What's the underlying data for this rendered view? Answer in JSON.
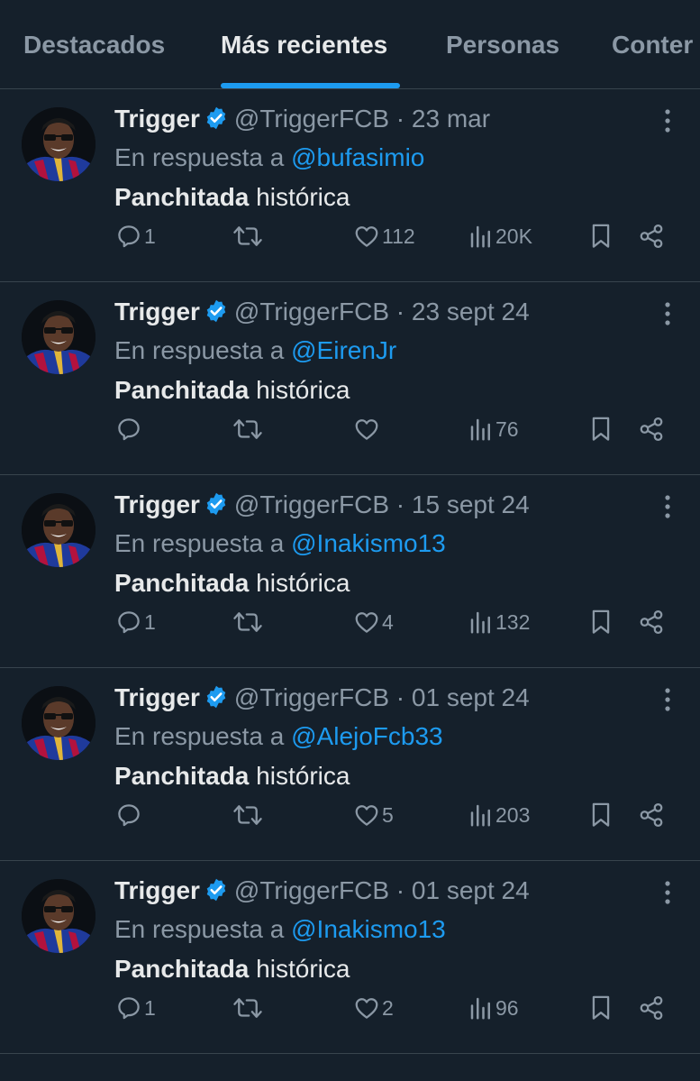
{
  "tabs": [
    {
      "label": "Destacados",
      "active": false
    },
    {
      "label": "Más recientes",
      "active": true
    },
    {
      "label": "Personas",
      "active": false
    },
    {
      "label": "Conter",
      "active": false
    }
  ],
  "colors": {
    "accent": "#1d9bf0",
    "background": "#15202b",
    "muted": "#8b98a5",
    "text": "#e7e9ea"
  },
  "tweets": [
    {
      "name": "Trigger",
      "handle": "@TriggerFCB",
      "sep": "·",
      "date": "23 mar",
      "reply_prefix": "En respuesta a",
      "reply_to": "@bufasimio",
      "body_bold": "Panchitada",
      "body_rest": " histórica",
      "replies": "1",
      "retweets": "",
      "likes": "112",
      "views": "20K"
    },
    {
      "name": "Trigger",
      "handle": "@TriggerFCB",
      "sep": "·",
      "date": "23 sept 24",
      "reply_prefix": "En respuesta a",
      "reply_to": "@EirenJr",
      "body_bold": "Panchitada",
      "body_rest": " histórica",
      "replies": "",
      "retweets": "",
      "likes": "",
      "views": "76"
    },
    {
      "name": "Trigger",
      "handle": "@TriggerFCB",
      "sep": "·",
      "date": "15 sept 24",
      "reply_prefix": "En respuesta a",
      "reply_to": "@Inakismo13",
      "body_bold": "Panchitada",
      "body_rest": " histórica",
      "replies": "1",
      "retweets": "",
      "likes": "4",
      "views": "132"
    },
    {
      "name": "Trigger",
      "handle": "@TriggerFCB",
      "sep": "·",
      "date": "01 sept 24",
      "reply_prefix": "En respuesta a",
      "reply_to": "@AlejoFcb33",
      "body_bold": "Panchitada",
      "body_rest": " histórica",
      "replies": "",
      "retweets": "",
      "likes": "5",
      "views": "203"
    },
    {
      "name": "Trigger",
      "handle": "@TriggerFCB",
      "sep": "·",
      "date": "01 sept 24",
      "reply_prefix": "En respuesta a",
      "reply_to": "@Inakismo13",
      "body_bold": "Panchitada",
      "body_rest": " histórica",
      "replies": "1",
      "retweets": "",
      "likes": "2",
      "views": "96"
    }
  ],
  "icons": {
    "reply": "reply-icon",
    "retweet": "retweet-icon",
    "like": "heart-icon",
    "views": "views-icon",
    "bookmark": "bookmark-icon",
    "share": "share-icon",
    "more": "more-icon",
    "verified": "verified-badge-icon"
  }
}
